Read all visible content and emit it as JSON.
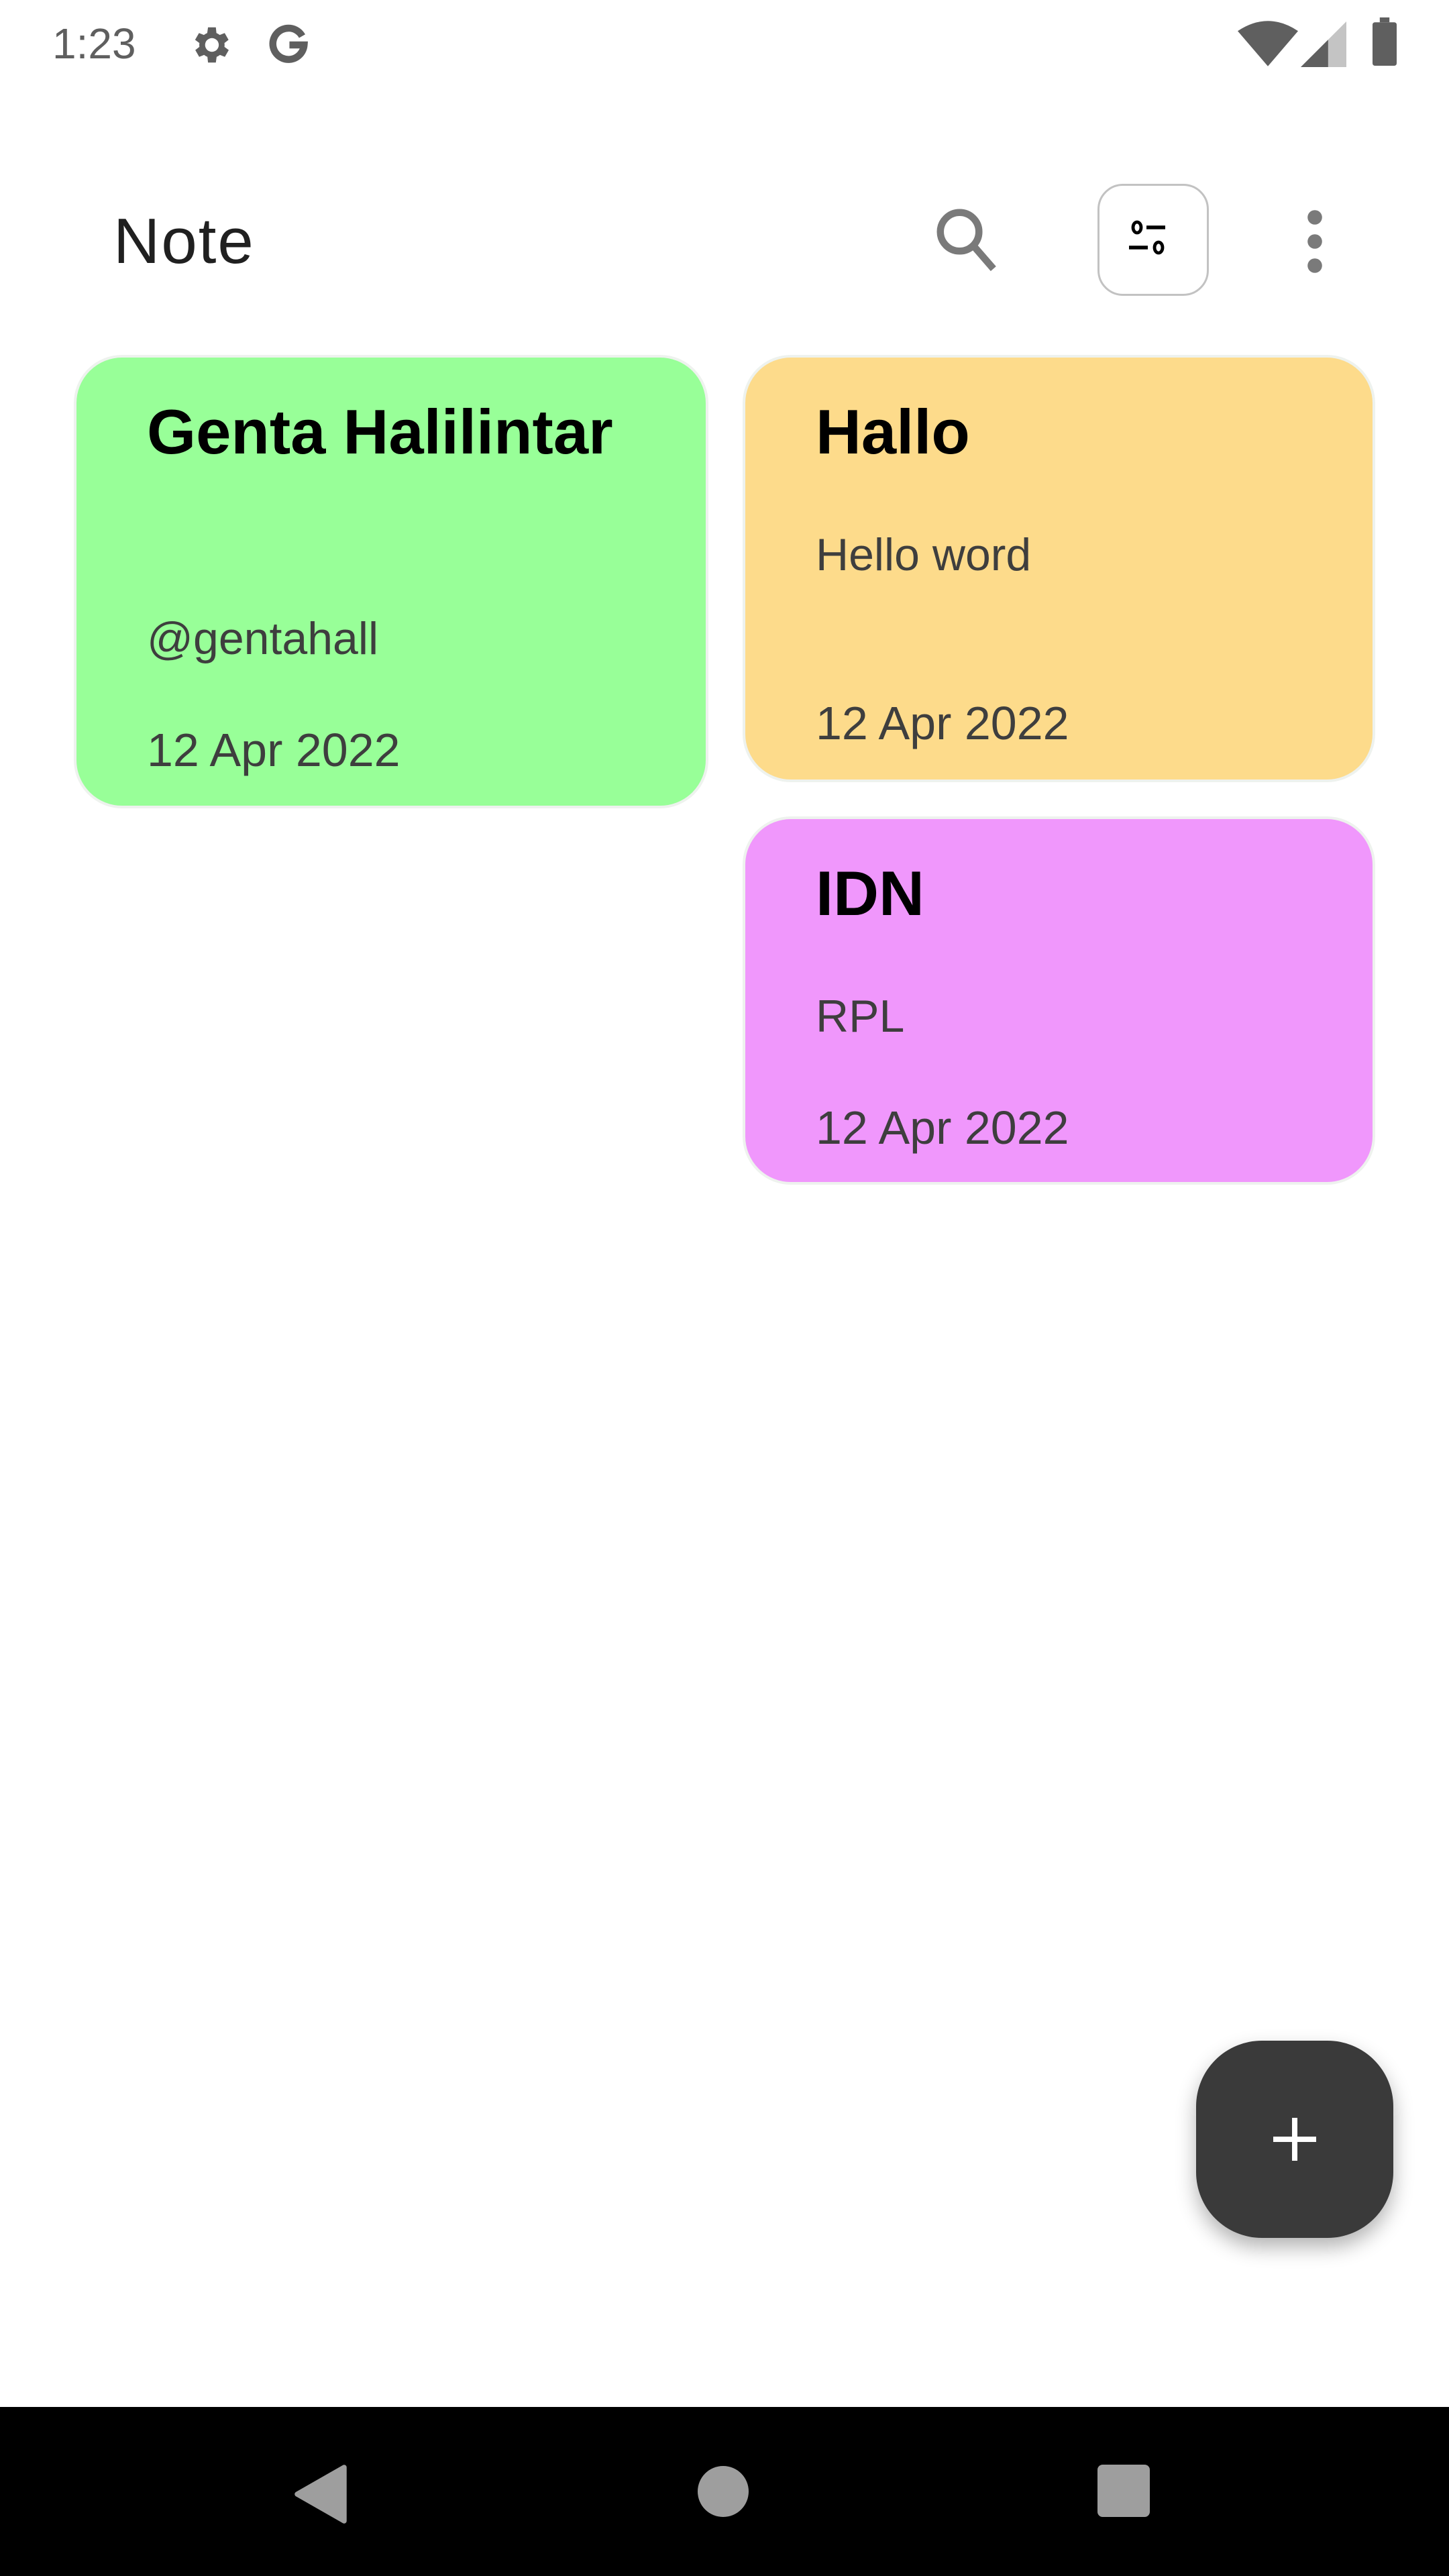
{
  "status_bar": {
    "time": "1:23",
    "icons": [
      "settings-icon",
      "google-icon",
      "wifi-icon",
      "signal-icon",
      "battery-icon"
    ]
  },
  "header": {
    "title": "Note",
    "actions": [
      "search-icon",
      "filter-icon",
      "more-vert-icon"
    ]
  },
  "notes": [
    {
      "title": "Genta Halilintar",
      "body": "@gentahall",
      "date": "12 Apr 2022",
      "color": "#98FF98"
    },
    {
      "title": "Hallo",
      "body": "Hello word",
      "date": "12 Apr 2022",
      "color": "#FDDB8B"
    },
    {
      "title": "IDN",
      "body": "RPL",
      "date": "12 Apr 2022",
      "color": "#F097FC"
    }
  ],
  "fab": {
    "icon": "plus-icon",
    "color": "#3A3A3A"
  },
  "nav_bar": {
    "icons": [
      "back-icon",
      "home-icon",
      "recents-icon"
    ]
  }
}
